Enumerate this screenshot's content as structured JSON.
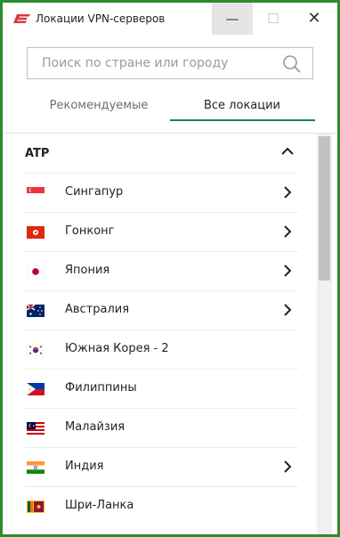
{
  "window": {
    "title": "Локации VPN-серверов",
    "minimize": "—",
    "maximize": "☐",
    "close": "✕"
  },
  "search": {
    "placeholder": "Поиск по стране или городу",
    "value": ""
  },
  "tabs": [
    {
      "label": "Рекомендуемые",
      "active": false
    },
    {
      "label": "Все локации",
      "active": true
    }
  ],
  "group": {
    "label": "ATP",
    "expanded": true
  },
  "locations": [
    {
      "name": "Сингапур",
      "flag": "sg-flag",
      "has_submenu": true
    },
    {
      "name": "Гонконг",
      "flag": "hk-flag",
      "has_submenu": true
    },
    {
      "name": "Япония",
      "flag": "jp-flag",
      "has_submenu": true
    },
    {
      "name": "Австралия",
      "flag": "au-flag",
      "has_submenu": true
    },
    {
      "name": "Южная Корея - 2",
      "flag": "kr-flag",
      "has_submenu": false
    },
    {
      "name": "Филиппины",
      "flag": "ph-flag",
      "has_submenu": false
    },
    {
      "name": "Малайзия",
      "flag": "my-flag",
      "has_submenu": false
    },
    {
      "name": "Индия",
      "flag": "in-flag",
      "has_submenu": true
    },
    {
      "name": "Шри-Ланка",
      "flag": "lk-flag",
      "has_submenu": false
    }
  ],
  "colors": {
    "border": "#2e8b2e",
    "accent": "#1a7f6b",
    "brand": "#da3940"
  }
}
